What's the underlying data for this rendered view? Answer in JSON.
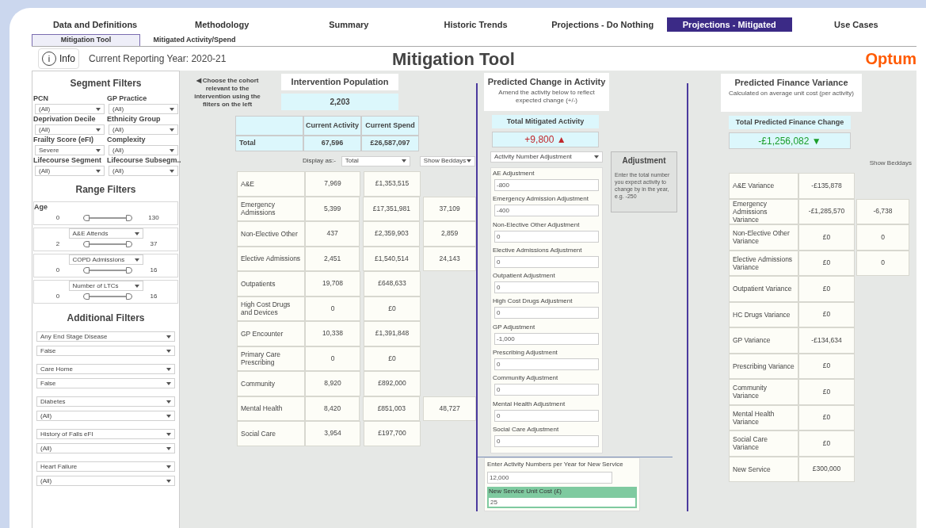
{
  "nav": {
    "tabs": [
      {
        "label": "Data and Definitions",
        "selected": false
      },
      {
        "label": "Methodology",
        "selected": false
      },
      {
        "label": "Summary",
        "selected": false
      },
      {
        "label": "Historic Trends",
        "selected": false
      },
      {
        "label": "Projections - Do Nothing",
        "selected": false
      },
      {
        "label": "Projections - Mitigated",
        "selected": true
      },
      {
        "label": "Use Cases",
        "selected": false
      }
    ],
    "subtabs": [
      {
        "label": "Mitigation Tool",
        "selected": true
      },
      {
        "label": "Mitigated Activity/Spend",
        "selected": false
      }
    ]
  },
  "header": {
    "info_button": "Info",
    "info_glyph": "i",
    "reporting_year": "Current Reporting Year: 2020-21",
    "title": "Mitigation Tool",
    "logo": "Optum"
  },
  "segment_filters": {
    "title": "Segment Filters",
    "filters": [
      {
        "label": "PCN",
        "value": "(All)"
      },
      {
        "label": "GP Practice",
        "value": "(All)"
      },
      {
        "label": "Deprivation Decile",
        "value": "(All)"
      },
      {
        "label": "Ethnicity Group",
        "value": "(All)"
      },
      {
        "label": "Frailty Score (eFI)",
        "value": "Severe"
      },
      {
        "label": "Complexity",
        "value": "(All)"
      },
      {
        "label": "Lifecourse Segment",
        "value": "(All)"
      },
      {
        "label": "Lifecourse Subsegm..",
        "value": "(All)"
      }
    ]
  },
  "range_filters": {
    "title": "Range Filters",
    "sliders": [
      {
        "kind": "label",
        "label": "Age",
        "min": "0",
        "max": "130",
        "level": 1
      },
      {
        "kind": "dropdown",
        "label": "A&E Attends",
        "min": "2",
        "max": "37",
        "level": 1
      },
      {
        "kind": "dropdown",
        "label": "COPD Admissions",
        "min": "0",
        "max": "16",
        "level": 1
      },
      {
        "kind": "dropdown",
        "label": "Number of LTCs",
        "min": "0",
        "max": "16",
        "level": 1
      }
    ]
  },
  "additional_filters": {
    "title": "Additional Filters",
    "filters": [
      {
        "field": "Any End Stage Disease",
        "value": "False"
      },
      {
        "field": "Care Home",
        "value": "False"
      },
      {
        "field": "Diabetes",
        "value": "(All)"
      },
      {
        "field": "History of Falls eFI",
        "value": "(All)"
      },
      {
        "field": "Heart Failure",
        "value": "(All)"
      }
    ]
  },
  "cohort_note": {
    "arrow": "◀",
    "text": "Choose the cohort relevant to the intervention using the filters on the left"
  },
  "intervention_population": {
    "title": "Intervention Population",
    "value": "2,203"
  },
  "activity_table": {
    "columns": [
      "Current Activity",
      "Current Spend"
    ],
    "total": {
      "label": "Total",
      "activity": "67,596",
      "spend": "£26,587,097"
    },
    "display_as_label": "Display as:-",
    "display_as_value": "Total",
    "beddays_dropdown": "Show Beddays",
    "rows": [
      {
        "label": "A&E",
        "activity": "7,969",
        "spend": "£1,353,515"
      },
      {
        "label": "Emergency Admissions",
        "activity": "5,399",
        "spend": "£17,351,981",
        "beddays": "37,109"
      },
      {
        "label": "Non-Elective Other",
        "activity": "437",
        "spend": "£2,359,903",
        "beddays": "2,859"
      },
      {
        "label": "Elective Admissions",
        "activity": "2,451",
        "spend": "£1,540,514",
        "beddays": "24,143"
      },
      {
        "label": "Outpatients",
        "activity": "19,708",
        "spend": "£648,633"
      },
      {
        "label": "High Cost Drugs and Devices",
        "activity": "0",
        "spend": "£0"
      },
      {
        "label": "GP Encounter",
        "activity": "10,338",
        "spend": "£1,391,848"
      },
      {
        "label": "Primary Care Prescribing",
        "activity": "0",
        "spend": "£0"
      },
      {
        "label": "Community",
        "activity": "8,920",
        "spend": "£892,000"
      },
      {
        "label": "Mental Health",
        "activity": "8,420",
        "spend": "£851,003",
        "beddays": "48,727"
      },
      {
        "label": "Social Care",
        "activity": "3,954",
        "spend": "£197,700"
      }
    ]
  },
  "predicted_change": {
    "title": "Predicted Change in Activity",
    "subtitle": "Amend the activity below to reflect expected change (+/-)",
    "total_label": "Total Mitigated Activity",
    "total_value": "+9,800",
    "arrow": "▲",
    "kind": "increase",
    "adjustment_type": "Activity Number Adjustment",
    "fields": [
      {
        "label": "AE Adjustment",
        "value": "-800"
      },
      {
        "label": "Emergency Admission Adjustment",
        "value": "-400"
      },
      {
        "label": "Non-Elective Other Adjustment",
        "value": "0"
      },
      {
        "label": "Elective Admissions Adjustment",
        "value": "0"
      },
      {
        "label": "Outpatient Adjustment",
        "value": "0"
      },
      {
        "label": "High Cost Drugs Adjustment",
        "value": "0"
      },
      {
        "label": "GP Adjustment",
        "value": "-1,000"
      },
      {
        "label": "Prescribing Adjustment",
        "value": "0"
      },
      {
        "label": "Community Adjustment",
        "value": "0"
      },
      {
        "label": "Mental Health Adjustment",
        "value": "0"
      },
      {
        "label": "Social Care Adjustment",
        "value": "0"
      }
    ],
    "new_service": {
      "activity_label": "Enter Activity Numbers per Year for New Service",
      "activity_value": "12,000",
      "cost_label": "New Service Unit Cost (£)",
      "cost_value": "25"
    }
  },
  "adjustment_note": {
    "title": "Adjustment",
    "text": "Enter the total number you expect activity to change by in the year, e.g. -250"
  },
  "finance": {
    "title": "Predicted Finance Variance",
    "subtitle": "Calculated on average unit cost (per activity)",
    "total_label": "Total Predicted Finance Change",
    "total_value": "-£1,256,082",
    "arrow": "▼",
    "kind": "decrease",
    "beddays_label": "Show Beddays",
    "rows": [
      {
        "label": "A&E Variance",
        "value": "-£135,878"
      },
      {
        "label": "Emergency Admissions Variance",
        "value": "-£1,285,570",
        "beddays": "-6,738"
      },
      {
        "label": "Non-Elective Other Variance",
        "value": "£0",
        "beddays": "0"
      },
      {
        "label": "Elective Admissions Variance",
        "value": "£0",
        "beddays": "0"
      },
      {
        "label": "Outpatient Variance",
        "value": "£0"
      },
      {
        "label": "HC Drugs Variance",
        "value": "£0"
      },
      {
        "label": "GP Variance",
        "value": "-£134,634"
      },
      {
        "label": "Prescribing Variance",
        "value": "£0"
      },
      {
        "label": "Community Variance",
        "value": "£0"
      },
      {
        "label": "Mental Health Variance",
        "value": "£0"
      },
      {
        "label": "Social Care Variance",
        "value": "£0"
      },
      {
        "label": "New Service",
        "value": "£300,000"
      }
    ]
  }
}
